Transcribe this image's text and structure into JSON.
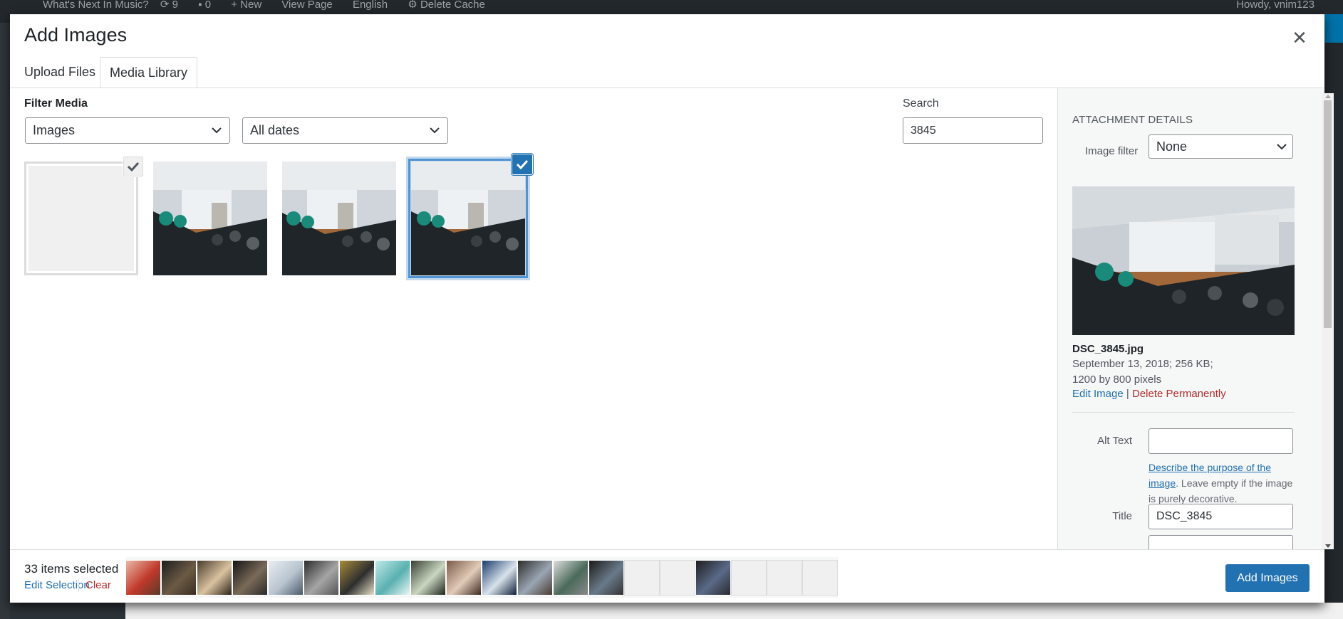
{
  "adminbar": {
    "site_name": "What's Next In Music?",
    "updates": "9",
    "comments": "0",
    "new": "New",
    "view_page": "View Page",
    "language": "English",
    "cache": "Delete Cache",
    "howdy": "Howdy, vnim123"
  },
  "modal": {
    "title": "Add Images",
    "close_icon": "close-icon"
  },
  "tabs": [
    {
      "label": "Upload Files",
      "active": false
    },
    {
      "label": "Media Library",
      "active": true
    }
  ],
  "filters": {
    "label": "Filter Media",
    "type_value": "Images",
    "date_value": "All dates"
  },
  "search": {
    "label": "Search",
    "value": "3845"
  },
  "grid": {
    "items": [
      {
        "kind": "blank",
        "checked": true,
        "check_style": "grey"
      },
      {
        "kind": "photo",
        "checked": false
      },
      {
        "kind": "photo",
        "checked": false
      },
      {
        "kind": "photo",
        "checked": true,
        "check_style": "blue",
        "focused": true
      }
    ]
  },
  "attachment": {
    "heading": "ATTACHMENT DETAILS",
    "image_filter_label": "Image filter",
    "image_filter_value": "None",
    "filename": "DSC_3845.jpg",
    "date_size": "September 13, 2018;  256 KB;",
    "dimensions": "1200 by 800 pixels",
    "edit_image": "Edit Image",
    "separator": "|",
    "delete_permanently": "Delete Permanently",
    "alt_text_label": "Alt Text",
    "alt_text_value": "",
    "describe_link": "Describe the purpose of the image",
    "describe_rest": ". Leave empty if the image is purely decorative.",
    "title_label": "Title",
    "title_value": "DSC_3845"
  },
  "toolbar": {
    "count": "33 items selected",
    "edit_selection": "Edit Selection",
    "clear": "Clear",
    "add_button": "Add Images"
  },
  "selection_thumbs": [
    "photo",
    "photo",
    "photo",
    "photo",
    "photo",
    "photo",
    "photo",
    "photo",
    "photo",
    "photo",
    "photo",
    "photo",
    "photo",
    "photo",
    "empty",
    "empty",
    "photo",
    "empty",
    "empty",
    "empty"
  ],
  "colors": {
    "accent": "#2271b1",
    "danger": "#b32d2e",
    "focus_ring": "#4f94d4"
  }
}
